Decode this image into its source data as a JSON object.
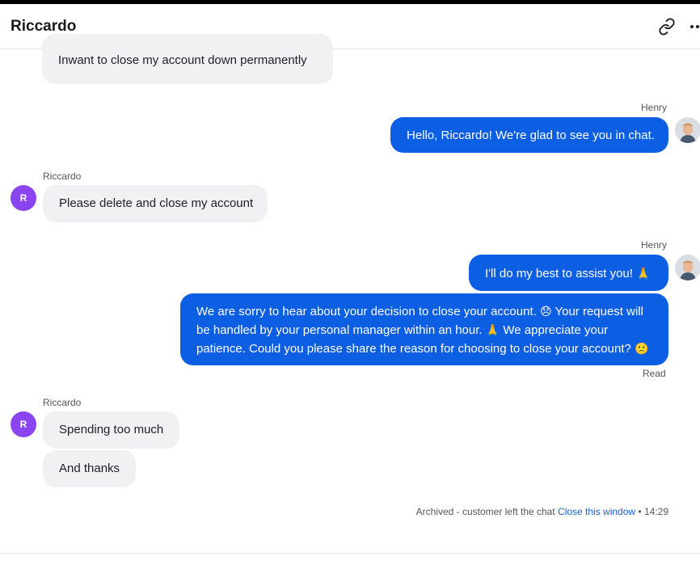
{
  "header": {
    "title": "Riccardo"
  },
  "messages": {
    "m0": {
      "text": "Inwant to close my account down permanently"
    },
    "henry_label_1": "Henry",
    "m1": {
      "text": "Hello, Riccardo! We're glad to see you in chat."
    },
    "riccardo_label_1": "Riccardo",
    "avatar_initial": "R",
    "m2": {
      "text": "Please delete and close my account"
    },
    "henry_label_2": "Henry",
    "m3": {
      "text": "I'll do my best to assist you!",
      "emoji": "🙏"
    },
    "m4": {
      "part1": "We are sorry to hear about your decision to close your account.",
      "emoji1": "😞",
      "part2": "Your request will be handled by your personal manager within an hour.",
      "emoji2": "🙏",
      "part3": "We appreciate your patience. Could you please share the reason for choosing to close your account?",
      "emoji3": "🙁"
    },
    "read_status": "Read",
    "riccardo_label_2": "Riccardo",
    "m5": {
      "text": "Spending too much"
    },
    "m6": {
      "text": "And thanks"
    }
  },
  "system": {
    "text": "Archived - customer left the chat",
    "link": "Close this window",
    "separator": "•",
    "time": "14:29"
  },
  "icons": {
    "link": "link-icon",
    "more": "more-icon",
    "agent_avatar": "agent-avatar-henry"
  },
  "colors": {
    "outgoing_bubble": "#0c5fe2",
    "incoming_bubble": "#f1f1f3",
    "avatar_r": "#8b45f0",
    "link": "#1a5fd0"
  }
}
